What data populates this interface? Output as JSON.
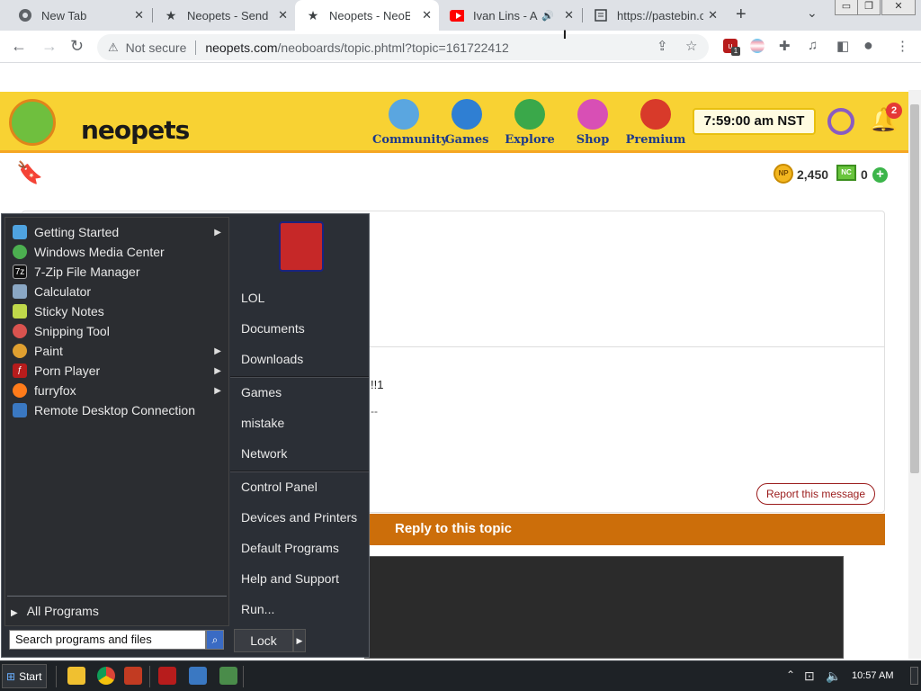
{
  "browser": {
    "tabs": [
      {
        "title": "New Tab",
        "close": "✕"
      },
      {
        "title": "Neopets - Send a",
        "close": "✕"
      },
      {
        "title": "Neopets - NeoBo",
        "close": "✕"
      },
      {
        "title": "Ivan Lins - Ar",
        "close": "✕"
      },
      {
        "title": "https://pastebin.c",
        "close": "✕"
      }
    ],
    "new_tab": "+",
    "security_label": "Not secure",
    "url_domain": "neopets.com",
    "url_path": "/neoboards/topic.phtml?topic=161722412",
    "ext_badge": "1"
  },
  "neopets": {
    "brand": "neopets",
    "nav": [
      {
        "label": "Community",
        "color": "#5aa6e0"
      },
      {
        "label": "Games",
        "color": "#2f7fd3"
      },
      {
        "label": "Explore",
        "color": "#3aa84a"
      },
      {
        "label": "Shop",
        "color": "#d84fb5"
      },
      {
        "label": "Premium",
        "color": "#d83a2a"
      }
    ],
    "clock": "7:59:00 am NST",
    "notification_count": "2",
    "np_coin": "NP",
    "neopoints": "2,450",
    "nc_icon": "NC",
    "neocash": "0",
    "nc_add": "+",
    "post_text_1": "!!1",
    "post_text_2": "--",
    "report_label": "Report this message",
    "reply_title": "Reply to this topic"
  },
  "start_menu": {
    "programs": [
      {
        "label": "Getting Started",
        "icon": "getting-started-icon",
        "color": "#4fa3e0",
        "submenu": true
      },
      {
        "label": "Windows Media Center",
        "icon": "media-center-icon",
        "color": "#4caf50",
        "submenu": false
      },
      {
        "label": "7-Zip File Manager",
        "icon": "7zip-icon",
        "color": "#111111",
        "submenu": false
      },
      {
        "label": "Calculator",
        "icon": "calculator-icon",
        "color": "#8aa7c4",
        "submenu": false
      },
      {
        "label": "Sticky Notes",
        "icon": "sticky-notes-icon",
        "color": "#c0d84a",
        "submenu": false
      },
      {
        "label": "Snipping Tool",
        "icon": "snipping-tool-icon",
        "color": "#d9534f",
        "submenu": false
      },
      {
        "label": "Paint",
        "icon": "paint-icon",
        "color": "#e0a030",
        "submenu": true
      },
      {
        "label": "Porn Player",
        "icon": "flash-icon",
        "color": "#b71c1c",
        "submenu": true
      },
      {
        "label": "furryfox",
        "icon": "firefox-icon",
        "color": "#ff7b1a",
        "submenu": true
      },
      {
        "label": "Remote Desktop Connection",
        "icon": "remote-desktop-icon",
        "color": "#3a78c2",
        "submenu": false
      }
    ],
    "all_programs": "All Programs",
    "search_placeholder": "Search programs and files",
    "right_items": [
      {
        "label": "LOL"
      },
      {
        "label": "Documents"
      },
      {
        "label": "Downloads"
      },
      {
        "label": "Games"
      },
      {
        "label": "mistake"
      },
      {
        "label": "Network"
      },
      {
        "label": "Control Panel"
      },
      {
        "label": "Devices and Printers"
      },
      {
        "label": "Default Programs"
      },
      {
        "label": "Help and Support"
      },
      {
        "label": "Run..."
      }
    ],
    "lock_label": "Lock"
  },
  "taskbar": {
    "start_label": "Start",
    "clock": "10:57 AM"
  }
}
